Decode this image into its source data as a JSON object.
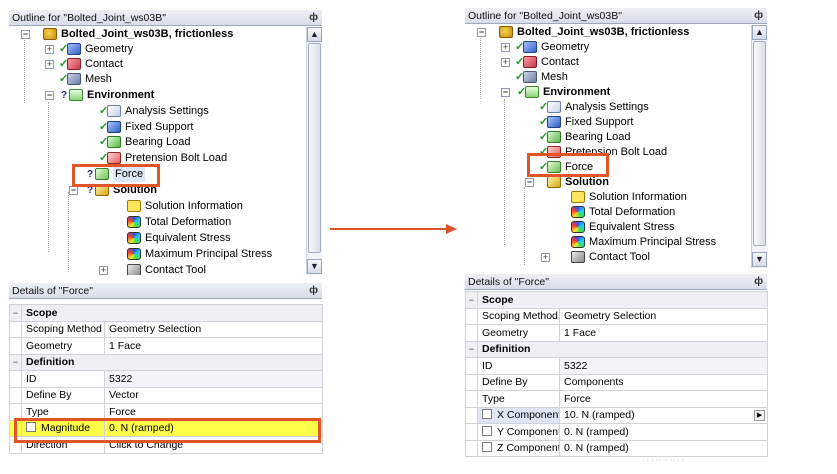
{
  "left": {
    "outline": {
      "title": "Outline for \"Bolted_Joint_ws03B\"",
      "pin": "ф",
      "items": [
        {
          "label": "Bolted_Joint_ws03B, frictionless",
          "icon": "model-icon",
          "bold": true
        },
        {
          "label": "Geometry",
          "icon": "geometry-icon"
        },
        {
          "label": "Contact",
          "icon": "contact-icon"
        },
        {
          "label": "Mesh",
          "icon": "mesh-icon"
        },
        {
          "label": "Environment",
          "icon": "environment-icon",
          "bold": true
        },
        {
          "label": "Analysis Settings",
          "icon": "analysis-settings-icon"
        },
        {
          "label": "Fixed Support",
          "icon": "fixed-support-icon"
        },
        {
          "label": "Bearing Load",
          "icon": "bearing-load-icon"
        },
        {
          "label": "Pretension Bolt Load",
          "icon": "bolt-load-icon"
        },
        {
          "label": "Force",
          "icon": "force-icon"
        },
        {
          "label": "Solution",
          "icon": "solution-icon",
          "bold": true
        },
        {
          "label": "Solution Information",
          "icon": "info-icon"
        },
        {
          "label": "Total Deformation",
          "icon": "contour-icon"
        },
        {
          "label": "Equivalent Stress",
          "icon": "contour-icon"
        },
        {
          "label": "Maximum Principal Stress",
          "icon": "contour-icon"
        },
        {
          "label": "Contact Tool",
          "icon": "contact-tool-icon"
        }
      ]
    },
    "details": {
      "title": "Details of \"Force\"",
      "pin": "ф",
      "scope_header": "Scope",
      "scoping_method_label": "Scoping Method",
      "scoping_method_value": "Geometry Selection",
      "geometry_label": "Geometry",
      "geometry_value": "1 Face",
      "definition_header": "Definition",
      "id_label": "ID",
      "id_value": "5322",
      "define_by_label": "Define By",
      "define_by_value": "Vector",
      "type_label": "Type",
      "type_value": "Force",
      "magnitude_label": "Magnitude",
      "magnitude_value": "0. N (ramped)",
      "direction_label": "Direction",
      "direction_value": "Click to Change"
    }
  },
  "right": {
    "outline": {
      "title": "Outline for \"Bolted_Joint_ws03B\"",
      "pin": "ф",
      "items": [
        {
          "label": "Bolted_Joint_ws03B, frictionless",
          "icon": "model-icon",
          "bold": true
        },
        {
          "label": "Geometry",
          "icon": "geometry-icon"
        },
        {
          "label": "Contact",
          "icon": "contact-icon"
        },
        {
          "label": "Mesh",
          "icon": "mesh-icon"
        },
        {
          "label": "Environment",
          "icon": "environment-icon",
          "bold": true
        },
        {
          "label": "Analysis Settings",
          "icon": "analysis-settings-icon"
        },
        {
          "label": "Fixed Support",
          "icon": "fixed-support-icon"
        },
        {
          "label": "Bearing Load",
          "icon": "bearing-load-icon"
        },
        {
          "label": "Pretension Bolt Load",
          "icon": "bolt-load-icon"
        },
        {
          "label": "Force",
          "icon": "force-icon"
        },
        {
          "label": "Solution",
          "icon": "solution-icon",
          "bold": true
        },
        {
          "label": "Solution Information",
          "icon": "info-icon"
        },
        {
          "label": "Total Deformation",
          "icon": "contour-icon"
        },
        {
          "label": "Equivalent Stress",
          "icon": "contour-icon"
        },
        {
          "label": "Maximum Principal Stress",
          "icon": "contour-icon"
        },
        {
          "label": "Contact Tool",
          "icon": "contact-tool-icon"
        }
      ]
    },
    "details": {
      "title": "Details of \"Force\"",
      "pin": "ф",
      "scope_header": "Scope",
      "scoping_method_label": "Scoping Method",
      "scoping_method_value": "Geometry Selection",
      "geometry_label": "Geometry",
      "geometry_value": "1 Face",
      "definition_header": "Definition",
      "id_label": "ID",
      "id_value": "5322",
      "define_by_label": "Define By",
      "define_by_value": "Components",
      "type_label": "Type",
      "type_value": "Force",
      "x_component_label": "X Component",
      "x_component_value": "10. N (ramped)",
      "y_component_label": "Y Component",
      "y_component_value": "0. N (ramped)",
      "z_component_label": "Z Component",
      "z_component_value": "0. N (ramped)"
    }
  },
  "colors": {
    "highlight_border": "#e0552a",
    "arrow": "#d9532b",
    "magnitude_highlight": "#ffff4a"
  }
}
